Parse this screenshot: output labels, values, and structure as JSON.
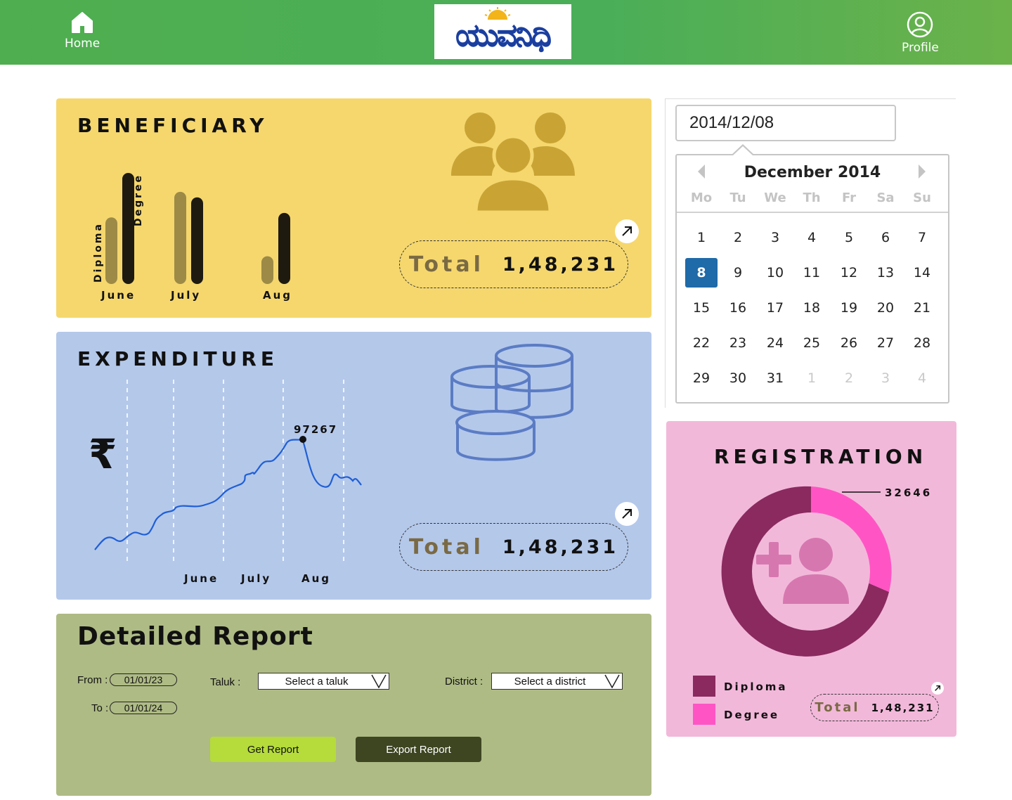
{
  "header": {
    "home_label": "Home",
    "profile_label": "Profile",
    "logo_text": "ಯುವನಿಧಿ"
  },
  "beneficiary": {
    "title": "BENEFICIARY",
    "total_label": "Total",
    "total_value": "1,48,231",
    "series_labels": [
      "Diploma",
      "Degree"
    ],
    "chart_data": {
      "type": "bar",
      "categories": [
        "June",
        "July",
        "Aug"
      ],
      "series": [
        {
          "name": "Diploma",
          "values": [
            60,
            83,
            25
          ]
        },
        {
          "name": "Degree",
          "values": [
            100,
            78,
            64
          ]
        }
      ]
    }
  },
  "expenditure": {
    "title": "EXPENDITURE",
    "currency_symbol": "₹",
    "total_label": "Total",
    "total_value": "1,48,231",
    "peak_label": "97267",
    "x_labels": [
      "June",
      "July",
      "Aug"
    ]
  },
  "calendar": {
    "input_value": "2014/12/08",
    "month_label": "December 2014",
    "weekdays": [
      "Mo",
      "Tu",
      "We",
      "Th",
      "Fr",
      "Sa",
      "Su"
    ],
    "weeks": [
      [
        "1",
        "2",
        "3",
        "4",
        "5",
        "6",
        "7"
      ],
      [
        "8",
        "9",
        "10",
        "11",
        "12",
        "13",
        "14"
      ],
      [
        "15",
        "16",
        "17",
        "18",
        "19",
        "20",
        "21"
      ],
      [
        "22",
        "23",
        "24",
        "25",
        "26",
        "27",
        "28"
      ],
      [
        "29",
        "30",
        "31",
        "1",
        "2",
        "3",
        "4"
      ]
    ],
    "selected_day": "8"
  },
  "registration": {
    "title": "REGISTRATION",
    "callout_value": "32646",
    "legend": [
      "Diploma",
      "Degree"
    ],
    "total_label": "Total",
    "total_value": "1,48,231",
    "colors": {
      "diploma": "#8a2a5f",
      "degree": "#ff55c4"
    }
  },
  "report": {
    "title": "Detailed Report",
    "from_label": "From :",
    "from_value": "01/01/23",
    "to_label": "To :",
    "to_value": "01/01/24",
    "taluk_label": "Taluk :",
    "taluk_placeholder": "Select a taluk",
    "district_label": "District :",
    "district_placeholder": "Select a district",
    "get_report_label": "Get Report",
    "export_report_label": "Export Report"
  }
}
